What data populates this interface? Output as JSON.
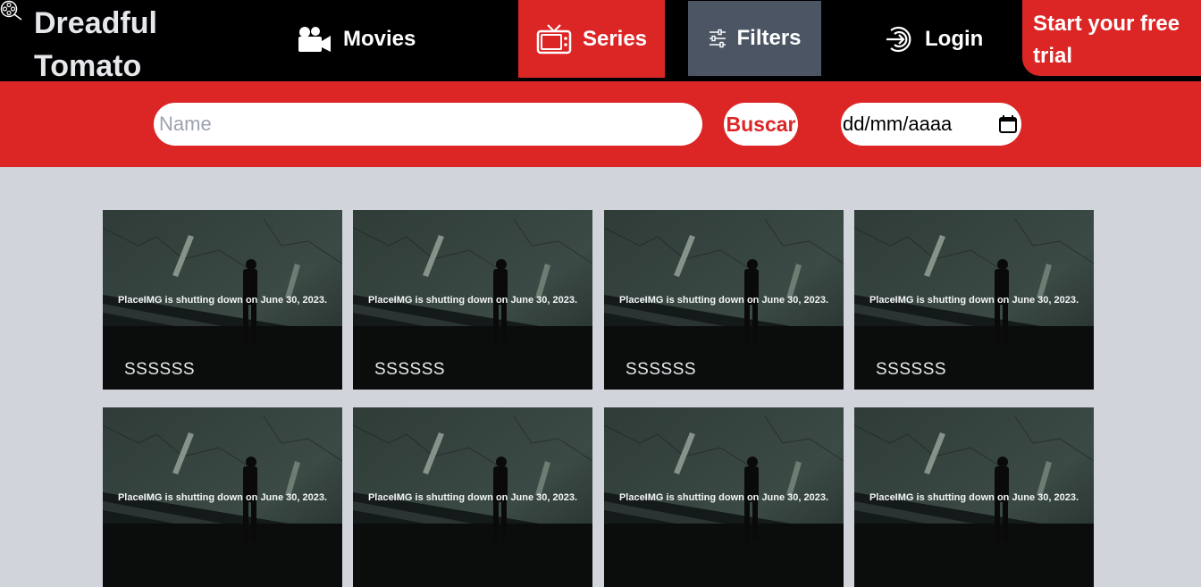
{
  "brand": {
    "line1": "Dreadful",
    "line2": "Tomato",
    "icon": "film-reel-icon"
  },
  "nav": {
    "movies": {
      "label": "Movies",
      "icon": "movie-camera-icon"
    },
    "series": {
      "label": "Series",
      "icon": "tv-icon",
      "active": true
    },
    "filters": {
      "label": "Filters",
      "icon": "sliders-icon"
    },
    "login": {
      "label": "Login",
      "icon": "login-icon"
    }
  },
  "trial": {
    "label": "Start your free trial"
  },
  "search": {
    "placeholder": "Name",
    "button_label": "Buscar",
    "date_placeholder": "dd/mm/aaaa",
    "date_icon": "calendar-icon"
  },
  "cards": [
    {
      "notice": "PlaceIMG is shutting down on June 30, 2023.",
      "title": "SSSSSS"
    },
    {
      "notice": "PlaceIMG is shutting down on June 30, 2023.",
      "title": "SSSSSS"
    },
    {
      "notice": "PlaceIMG is shutting down on June 30, 2023.",
      "title": "SSSSSS"
    },
    {
      "notice": "PlaceIMG is shutting down on June 30, 2023.",
      "title": "SSSSSS"
    },
    {
      "notice": "PlaceIMG is shutting down on June 30, 2023.",
      "title": ""
    },
    {
      "notice": "PlaceIMG is shutting down on June 30, 2023.",
      "title": ""
    },
    {
      "notice": "PlaceIMG is shutting down on June 30, 2023.",
      "title": ""
    },
    {
      "notice": "PlaceIMG is shutting down on June 30, 2023.",
      "title": ""
    }
  ],
  "colors": {
    "accent": "#dc2626",
    "header_bg": "#000000",
    "page_bg": "#d1d5db",
    "filters_bg": "#4b5563"
  }
}
